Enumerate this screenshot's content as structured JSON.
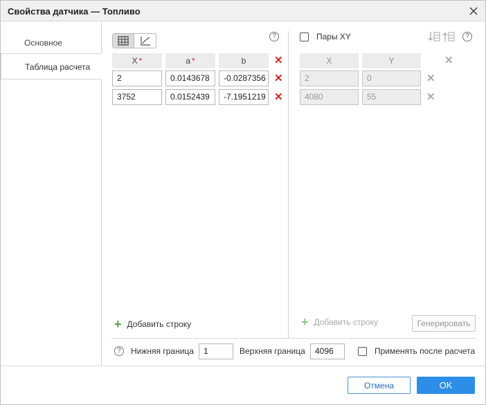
{
  "window": {
    "title": "Свойства датчика — Топливо"
  },
  "sidebar": {
    "tabs": [
      {
        "label": "Основное",
        "active": false
      },
      {
        "label": "Таблица расчета",
        "active": true
      }
    ]
  },
  "left_table": {
    "headers": [
      {
        "label": "X",
        "required": true
      },
      {
        "label": "a",
        "required": true
      },
      {
        "label": "b",
        "required": false
      }
    ],
    "rows": [
      [
        "2",
        "0.0143678",
        "-0.0287356"
      ],
      [
        "3752",
        "0.0152439",
        "-7.1951219"
      ]
    ],
    "add_row_label": "Добавить строку"
  },
  "right_table": {
    "pairs_label": "Пары XY",
    "pairs_checked": false,
    "headers": [
      "X",
      "Y"
    ],
    "rows": [
      [
        "2",
        "0"
      ],
      [
        "4080",
        "55"
      ]
    ],
    "add_row_label": "Добавить строку",
    "generate_label": "Генерировать"
  },
  "bounds": {
    "lower_label": "Нижняя граница",
    "lower_value": "1",
    "upper_label": "Верхняя граница",
    "upper_value": "4096",
    "apply_after_label": "Применять после расчета",
    "apply_after_checked": false
  },
  "help_symbol": "?",
  "delete_symbol": "✕",
  "footer": {
    "cancel_label": "Отмена",
    "ok_label": "OK"
  },
  "colors": {
    "accent": "#2d8ee8",
    "required_star": "#e02020",
    "add_icon": "#4aa44a"
  }
}
